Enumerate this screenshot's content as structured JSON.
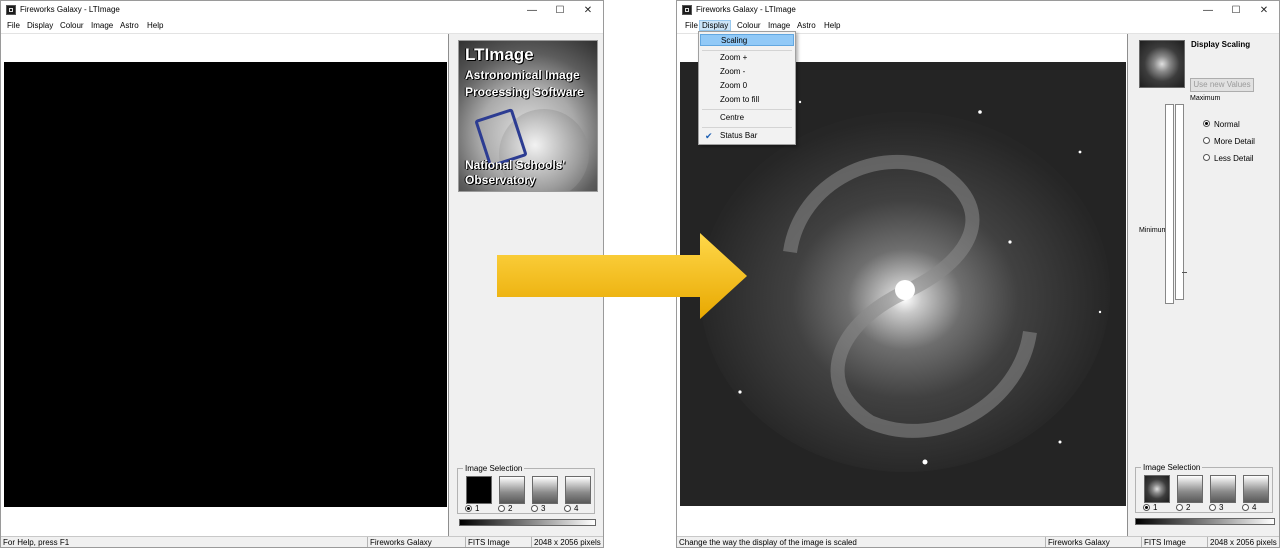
{
  "colors": {
    "accent_highlight": "#91c9f7",
    "arrow_yellow": "#f2b705",
    "image_bg": "#000000"
  },
  "left_window": {
    "title": "Fireworks Galaxy - LTImage",
    "menu": [
      "File",
      "Display",
      "Colour",
      "Image",
      "Astro",
      "Help"
    ],
    "window_controls": {
      "minimize": "—",
      "maximize": "☐",
      "close": "✕"
    },
    "logo": {
      "line1": "LTImage",
      "line2": "Astronomical Image",
      "line3": "Processing Software",
      "line4": "National Schools'",
      "line5": "Observatory"
    },
    "image_selection": {
      "label": "Image Selection",
      "options": [
        "1",
        "2",
        "3",
        "4"
      ],
      "selected": "1"
    },
    "status": {
      "message": "For Help, press F1",
      "object": "Fireworks Galaxy",
      "type": "FITS Image",
      "size": "2048 x 2056 pixels"
    }
  },
  "right_window": {
    "title": "Fireworks Galaxy - LTImage",
    "menu": [
      "File",
      "Display",
      "Colour",
      "Image",
      "Astro",
      "Help"
    ],
    "active_menu": "Display",
    "window_controls": {
      "minimize": "—",
      "maximize": "☐",
      "close": "✕"
    },
    "dropdown": {
      "items": [
        "Scaling",
        "Zoom +",
        "Zoom -",
        "Zoom 0",
        "Zoom to fill",
        "Centre",
        "Status Bar"
      ],
      "highlighted": "Scaling",
      "checked": "Status Bar",
      "check_glyph": "✔"
    },
    "scaling_panel": {
      "title": "Display Scaling",
      "use_new_values": "Use new Values",
      "maximum": "Maximum",
      "minimum": "Minimum",
      "options": [
        "Normal",
        "More Detail",
        "Less Detail"
      ],
      "selected": "Normal"
    },
    "image_selection": {
      "label": "Image Selection",
      "options": [
        "1",
        "2",
        "3",
        "4"
      ],
      "selected": "1"
    },
    "status": {
      "message": "Change the way the display of the image is scaled",
      "object": "Fireworks Galaxy",
      "type": "FITS Image",
      "size": "2048 x 2056 pixels"
    }
  }
}
